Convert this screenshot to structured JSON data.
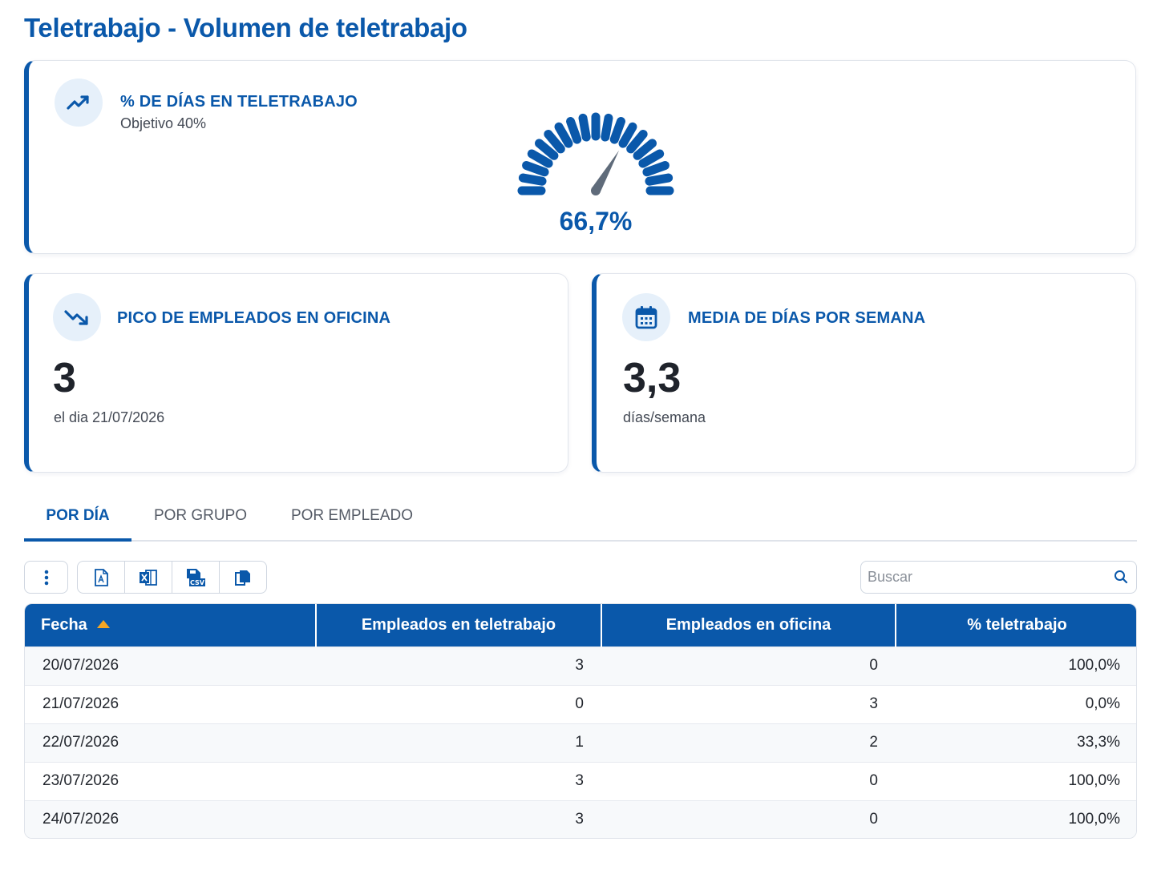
{
  "page": {
    "title": "Teletrabajo - Volumen de teletrabajo"
  },
  "cards": {
    "remote_days": {
      "icon": "trending-up-icon",
      "title": "% DE DÍAS EN TELETRABAJO",
      "subtitle": "Objetivo 40%",
      "value": "66,7%",
      "gauge_fraction": 0.667
    },
    "office_peak": {
      "icon": "trending-down-icon",
      "title": "PICO DE EMPLEADOS EN OFICINA",
      "value": "3",
      "subtitle": "el dia 21/07/2026"
    },
    "avg_days": {
      "icon": "calendar-icon",
      "title": "MEDIA DE DÍAS POR SEMANA",
      "value": "3,3",
      "subtitle": "días/semana"
    }
  },
  "tabs": [
    {
      "label": "POR DÍA",
      "active": true
    },
    {
      "label": "POR GRUPO",
      "active": false
    },
    {
      "label": "POR EMPLEADO",
      "active": false
    }
  ],
  "toolbar": {
    "menu_icon": "vertical-dots-icon",
    "export_icons": [
      "pdf-icon",
      "excel-icon",
      "csv-icon",
      "copy-icon"
    ],
    "search_placeholder": "Buscar",
    "search_icon": "search-icon"
  },
  "table": {
    "columns": [
      "Fecha",
      "Empleados en teletrabajo",
      "Empleados en oficina",
      "% teletrabajo"
    ],
    "sort": {
      "column": "Fecha",
      "direction": "asc"
    },
    "rows": [
      [
        "20/07/2026",
        "3",
        "0",
        "100,0%"
      ],
      [
        "21/07/2026",
        "0",
        "3",
        "0,0%"
      ],
      [
        "22/07/2026",
        "1",
        "2",
        "33,3%"
      ],
      [
        "23/07/2026",
        "3",
        "0",
        "100,0%"
      ],
      [
        "24/07/2026",
        "3",
        "0",
        "100,0%"
      ]
    ]
  },
  "colors": {
    "primary": "#0a58aa",
    "sort_arrow": "#f5a623",
    "needle": "#5f6b7a"
  }
}
